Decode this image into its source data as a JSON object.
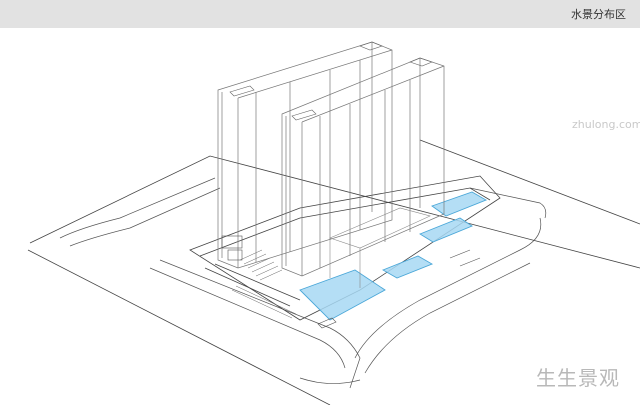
{
  "header": {
    "title": "水景分布区"
  },
  "watermark": {
    "url": "zhulong.com",
    "text": "生生景观"
  },
  "colors": {
    "header_bg": "#e2e2e2",
    "water": "#a7d8f3",
    "water_stroke": "#4aa7d8",
    "line": "#555555"
  }
}
